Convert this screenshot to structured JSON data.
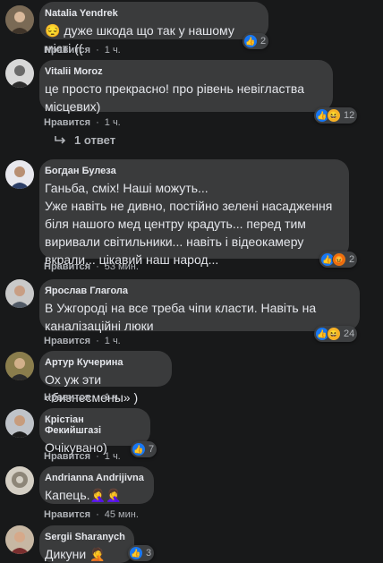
{
  "comments": [
    {
      "author": "Natalia Yendrek",
      "text": "😔 дуже шкода що так у нашому місті ((",
      "like": "Нравится",
      "time": "1 ч.",
      "reactions_count": "2"
    },
    {
      "author": "Vitalii Moroz",
      "text": "це просто прекрасно! про рівень невігластва місцевих)",
      "like": "Нравится",
      "time": "1 ч.",
      "reactions_count": "12"
    },
    {
      "author": "Богдан Булеза",
      "text": "Ганьба, сміх! Наші можуть...\nУже навіть не дивно, постійно зелені насадження біля нашого мед центру крадуть... перед тим виривали світильники... навіть і відеокамеру вкрали... цікавий наш народ...",
      "like": "Нравится",
      "time": "53 мин.",
      "reactions_count": "2"
    },
    {
      "author": "Ярослав Глагола",
      "text": "В Ужгороді на все треба чіпи класти. Навіть на каналізаційні люки",
      "like": "Нравится",
      "time": "1 ч.",
      "reactions_count": "24"
    },
    {
      "author": "Артур Кучерина",
      "text": "Ох уж эти «бизнесмены» )",
      "like": "Нравится",
      "time": "1 ч.",
      "reactions_count": ""
    },
    {
      "author": "Крістіан Фекийшгазі",
      "text": "Очікувано)",
      "like": "Нравится",
      "time": "1 ч.",
      "reactions_count": "7"
    },
    {
      "author": "Andrianna Andrijivna",
      "text": "Капець.🤦‍♀️🤦‍♀️",
      "like": "Нравится",
      "time": "45 мин.",
      "reactions_count": ""
    },
    {
      "author": "Sergii Sharanych",
      "text": "Дикуни 🤦",
      "like": "",
      "time": "",
      "reactions_count": "3"
    }
  ],
  "replies_link": "1 ответ",
  "colors": {
    "background": "#18191a",
    "bubble": "#3a3b3c",
    "like_blue": "#1877f2"
  }
}
